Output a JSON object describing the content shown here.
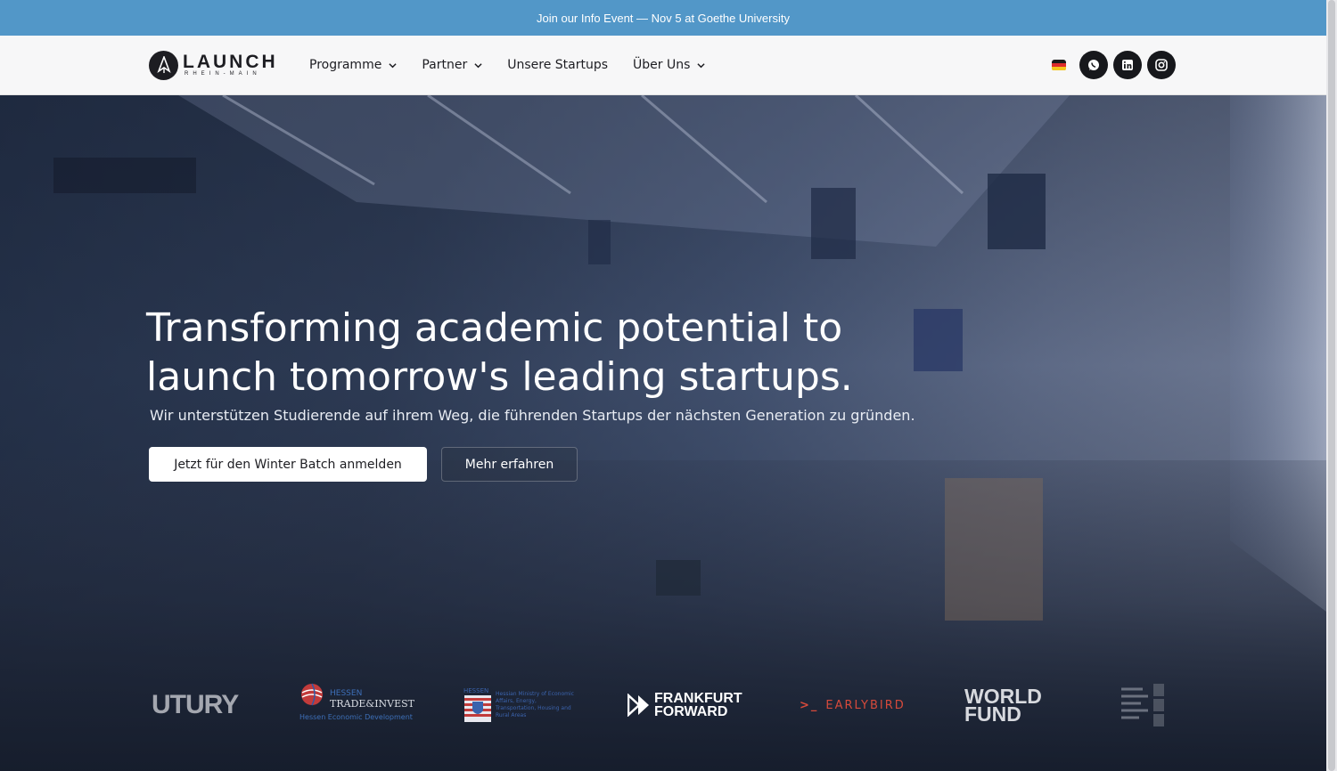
{
  "announcement": {
    "text": "Join our Info Event — Nov 5 at Goethe University"
  },
  "nav": {
    "logo_word": "LAUNCH",
    "logo_sub": "RHEIN-MAIN",
    "items": [
      {
        "label": "Programme",
        "has_dropdown": true
      },
      {
        "label": "Partner",
        "has_dropdown": true
      },
      {
        "label": "Unsere Startups",
        "has_dropdown": false
      },
      {
        "label": "Über Uns",
        "has_dropdown": true
      }
    ],
    "language_flag": "german-flag-icon",
    "social_icons": [
      "whatsapp-icon",
      "linkedin-icon",
      "instagram-icon"
    ]
  },
  "hero": {
    "title_line1": "Transforming academic potential to",
    "title_line2": "launch tomorrow's leading startups.",
    "subtitle": "Wir unterstützen Studierende auf ihrem Weg, die führenden Startups der nächsten Generation zu gründen.",
    "cta_primary": "Jetzt für den Winter Batch anmelden",
    "cta_secondary": "Mehr erfahren"
  },
  "partners": {
    "futury": "UTURY",
    "hessen_trade_invest": {
      "line1": "HESSEN",
      "line2": "TRADE&INVEST",
      "line3": "Hessen Economic Development"
    },
    "hessen_ministry": {
      "label": "HESSEN",
      "text": "Hessian Ministry of Economic Affairs, Energy, Transportation, Housing and Rural Areas"
    },
    "frankfurt_forward": {
      "line1": "FRANKFURT",
      "line2": "FORWARD"
    },
    "earlybird": "EARLYBIRD",
    "world_fund": {
      "line1": "WORLD",
      "line2": "FUND"
    }
  },
  "colors": {
    "announcement_bg": "#5297c8",
    "navbar_bg": "#f7f7f8",
    "text_dark": "#1d1d22",
    "earlybird_red": "#d64a3b"
  }
}
